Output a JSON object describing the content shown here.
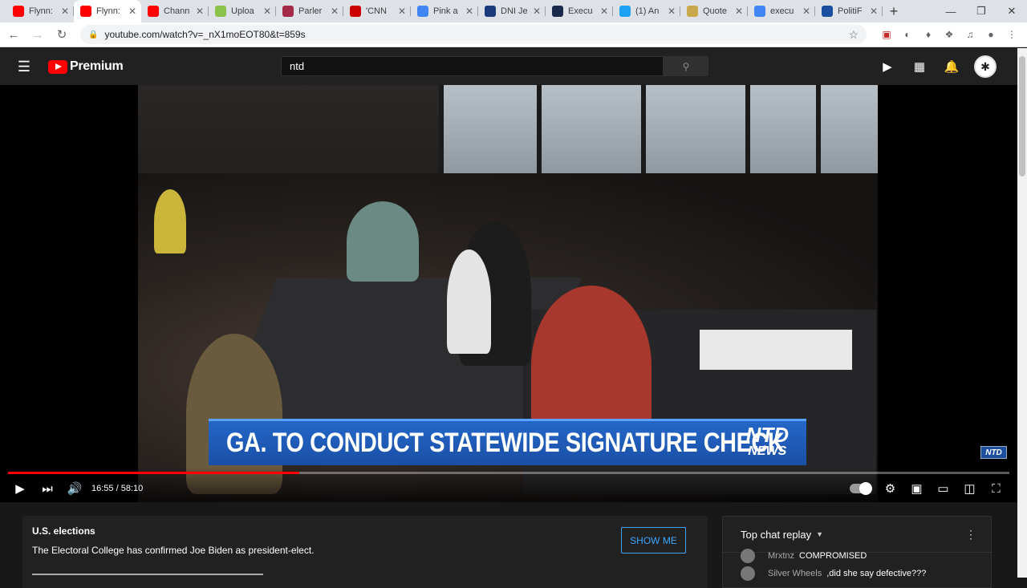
{
  "browser": {
    "tabs": [
      {
        "title": "Flynn:",
        "favicon": "youtube",
        "color": "#ff0000",
        "active": false
      },
      {
        "title": "Flynn:",
        "favicon": "youtube",
        "color": "#ff0000",
        "active": true
      },
      {
        "title": "Chann",
        "favicon": "youtube",
        "color": "#ff0000",
        "active": false
      },
      {
        "title": "Uploa",
        "favicon": "upload",
        "color": "#8bc34a",
        "active": false
      },
      {
        "title": "Parler",
        "favicon": "parler",
        "color": "#a52a4a",
        "active": false
      },
      {
        "title": "'CNN",
        "favicon": "cnn",
        "color": "#cc0000",
        "active": false
      },
      {
        "title": "Pink a",
        "favicon": "google",
        "color": "#4285f4",
        "active": false
      },
      {
        "title": "DNI Je",
        "favicon": "dni",
        "color": "#1a3a7a",
        "active": false
      },
      {
        "title": "Execu",
        "favicon": "execu",
        "color": "#1a2a4a",
        "active": false
      },
      {
        "title": "(1) An",
        "favicon": "twitter",
        "color": "#1da1f2",
        "active": false
      },
      {
        "title": "Quote",
        "favicon": "quote",
        "color": "#c8a84a",
        "active": false
      },
      {
        "title": "execu",
        "favicon": "google",
        "color": "#4285f4",
        "active": false
      },
      {
        "title": "PolitiF",
        "favicon": "politifact",
        "color": "#1a4fa0",
        "active": false
      }
    ],
    "url": "youtube.com/watch?v=_nX1moEOT80&t=859s"
  },
  "youtube": {
    "brand": "Premium",
    "search_value": "ntd"
  },
  "video": {
    "headline": "GA. TO CONDUCT STATEWIDE SIGNATURE CHECK",
    "ntd_logo_top": "NTD",
    "ntd_logo_bottom": "NEWS",
    "ntd_bug": "NTD",
    "current_time": "16:55",
    "duration": "58:10",
    "time_display": "16:55 / 58:10",
    "progress_fraction": 0.291
  },
  "info_card": {
    "title": "U.S. elections",
    "body": "The Electoral College has confirmed Joe Biden as president-elect.",
    "button": "SHOW ME"
  },
  "chat": {
    "header": "Top chat replay",
    "messages": [
      {
        "author": "Mrxtnz",
        "text": "COMPROMISED"
      },
      {
        "author": "Silver Wheels",
        "text": ",did she say defective???"
      }
    ]
  }
}
